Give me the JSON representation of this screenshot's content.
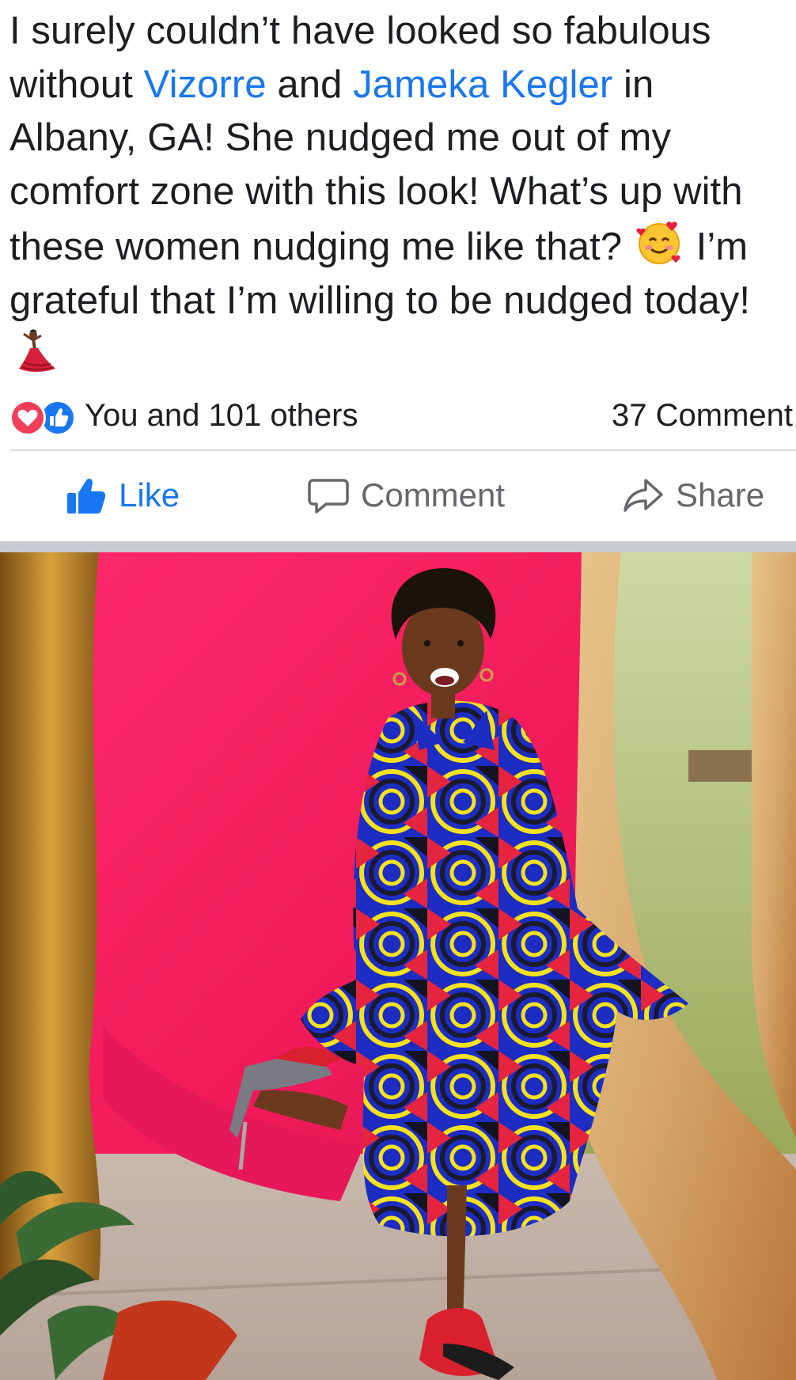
{
  "post": {
    "caption": {
      "part1": "I surely couldn’t have looked so fabulous without ",
      "mention1": "Vizorre",
      "part2": " and ",
      "mention2": "Jameka Kegler",
      "part3": " in Albany, GA! She nudged me out of my comfort zone with this look! What’s up with these women nudging me like that? ",
      "emoji1": "smiling-face-with-hearts",
      "part4": " I’m grateful that I’m willing to be nudged today! ",
      "emoji2": "woman-dancing"
    },
    "reactions": {
      "icons": [
        "love-reaction-icon",
        "like-reaction-icon"
      ],
      "summary": "You and 101 others",
      "comment_count": "37 Comment"
    },
    "actions": {
      "like_label": "Like",
      "comment_label": "Comment",
      "share_label": "Share"
    }
  },
  "colors": {
    "link": "#1877f2",
    "text": "#1c1e21",
    "secondary": "#65676b",
    "love": "#f33e58",
    "like": "#1877f2",
    "separator": "#c9ccd1"
  }
}
